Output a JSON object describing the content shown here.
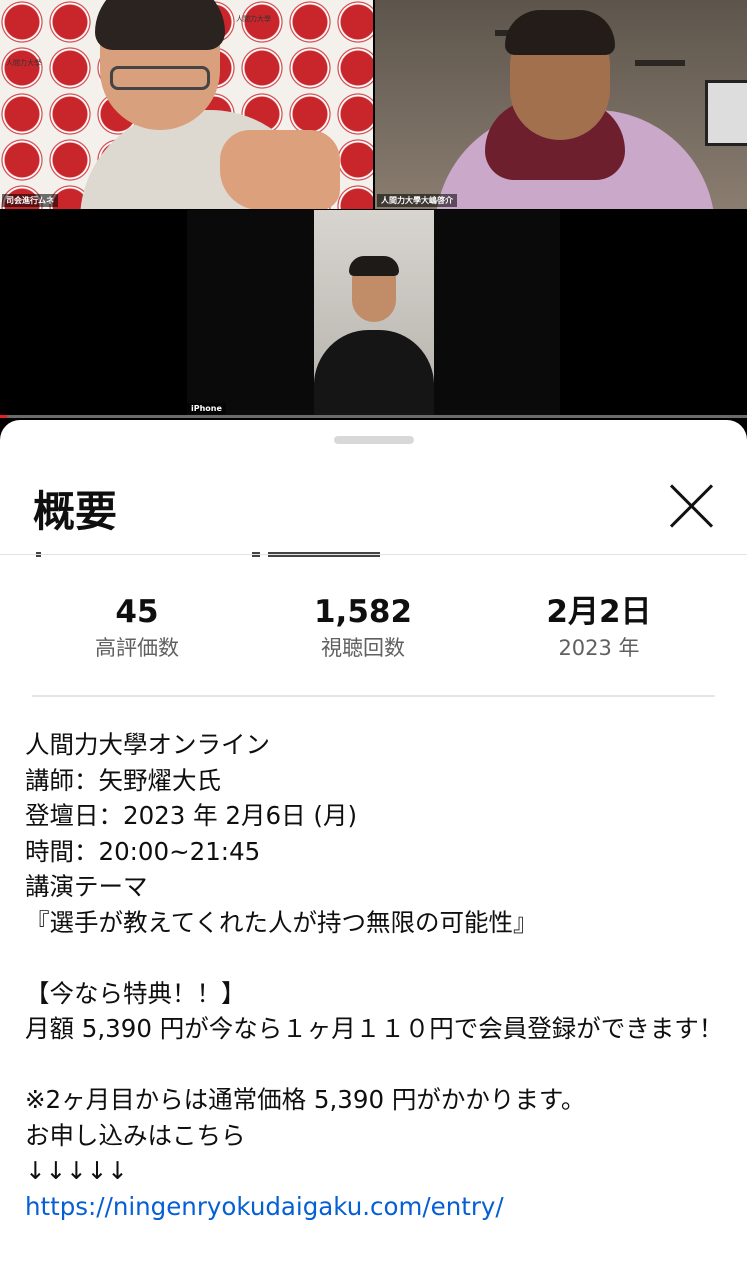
{
  "video": {
    "participants": [
      {
        "name_tag": "司会進行ムネ"
      },
      {
        "name_tag": "人間力大學大嶋啓介"
      },
      {
        "name_tag": "iPhone"
      }
    ],
    "backdrop_label": "人間力大學",
    "progress_fraction": 0.01,
    "colors": {
      "progress": "#e62117",
      "seal": "#c8262b"
    }
  },
  "sheet": {
    "title": "概要",
    "close_icon": "close-x-icon",
    "stats": [
      {
        "value": "45",
        "label": "高評価数"
      },
      {
        "value": "1,582",
        "label": "視聴回数"
      },
      {
        "value": "2月2日",
        "label": "2023 年"
      }
    ],
    "description": [
      "人間力大學オンライン",
      "講師：矢野燿大氏",
      "登壇日：2023 年 2月6日 (月)",
      "時間：20:00~21:45",
      "講演テーマ",
      "『選手が教えてくれた人が持つ無限の可能性』",
      "",
      "【今なら特典！！】",
      "月額 5,390 円が今なら１ヶ月１１０円で会員登録ができます！",
      "",
      "※2ヶ月目からは通常価格 5,390 円がかかります。",
      "お申し込みはこちら",
      "↓↓↓↓↓"
    ],
    "link": "https://ningenryokudaigaku.com/entry/",
    "colors": {
      "link": "#065fd4",
      "label": "#606060",
      "text": "#0f0f0f"
    }
  }
}
